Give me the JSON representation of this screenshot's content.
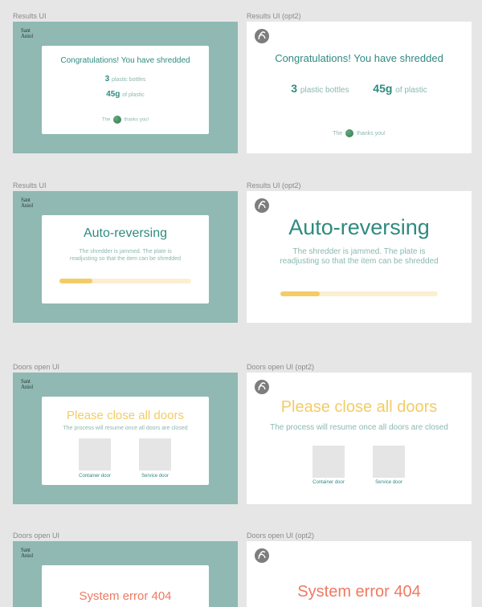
{
  "labels": {
    "results_ui": "Results UI",
    "results_ui_opt2": "Results UI (opt2)",
    "doors_open_ui": "Doors open UI",
    "doors_open_ui_opt2": "Doors open UI (opt2)"
  },
  "logo": {
    "line1": "Sant",
    "line2": "Aniol"
  },
  "results": {
    "title": "Congratulations! You have shredded",
    "bottles_count": "3",
    "bottles_label": "plastic bottles",
    "plastic_weight": "45g",
    "plastic_label": "of plastic",
    "thanks_prefix": "The",
    "thanks_suffix": "thanks you!"
  },
  "reversing": {
    "title": "Auto-reversing",
    "message": "The shredder is jammed. The plate is readjusting so that the item can be shredded",
    "progress": 0.25
  },
  "doors": {
    "title": "Please close all doors",
    "message": "The process will resume once all doors are closed",
    "container_door": "Container door",
    "service_door": "Service door"
  },
  "error": {
    "title": "System error 404"
  },
  "colors": {
    "teal_bg": "#8fb9b2",
    "teal_text": "#2f8a80",
    "yellow": "#f3cc67",
    "red": "#ee7a61"
  }
}
